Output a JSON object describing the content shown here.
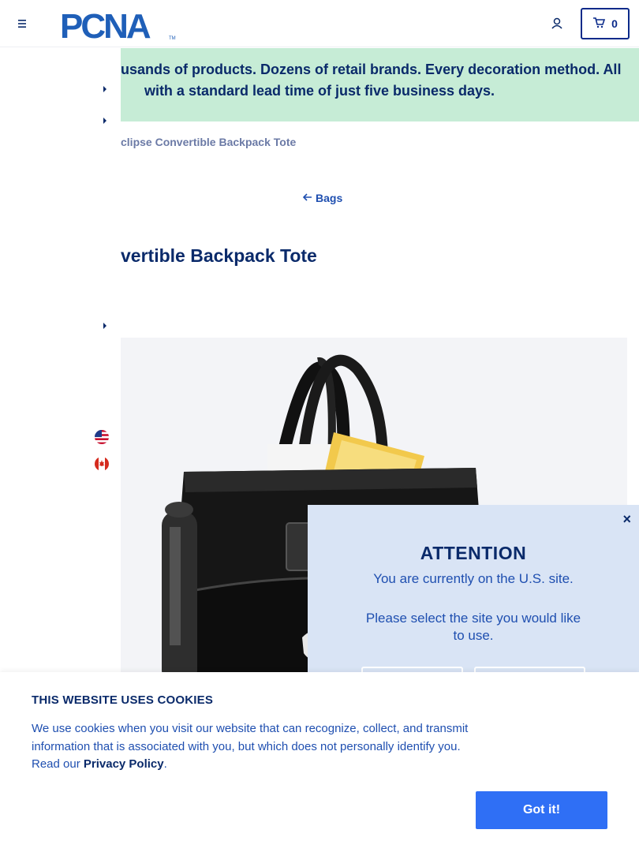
{
  "header": {
    "logo_text": "PCNA",
    "logo_tm": "TM",
    "cart_count": "0"
  },
  "banner": {
    "line1": "usands of products. Dozens of retail brands. Every decoration method. All",
    "line2": "with a standard lead time of just five business days."
  },
  "breadcrumb": "clipse Convertible Backpack Tote",
  "back_link": "Bags",
  "product_title": "vertible Backpack Tote",
  "modal": {
    "close": "×",
    "heading": "ATTENTION",
    "message": "You are currently on the U.S. site.",
    "prompt": "Please select the site you would like to use."
  },
  "cookie": {
    "heading": "THIS WEBSITE USES COOKIES",
    "text": "We use cookies when you visit our website that can recognize, collect, and transmit information that is associated with you, but which does not personally identify you. Read our ",
    "link": "Privacy Policy",
    "period": ".",
    "button": "Got it!"
  },
  "colors": {
    "navy": "#0a2a6a",
    "brand_blue": "#1f4fb0",
    "banner_bg": "#c6ecd6",
    "modal_bg": "#d9e4f5",
    "button_blue": "#2f6ff5"
  },
  "icons": [
    "hamburger-icon",
    "account-icon",
    "cart-icon",
    "back-arrow-icon",
    "chevron-right-icon",
    "us-flag-icon",
    "canada-flag-icon",
    "close-icon"
  ]
}
